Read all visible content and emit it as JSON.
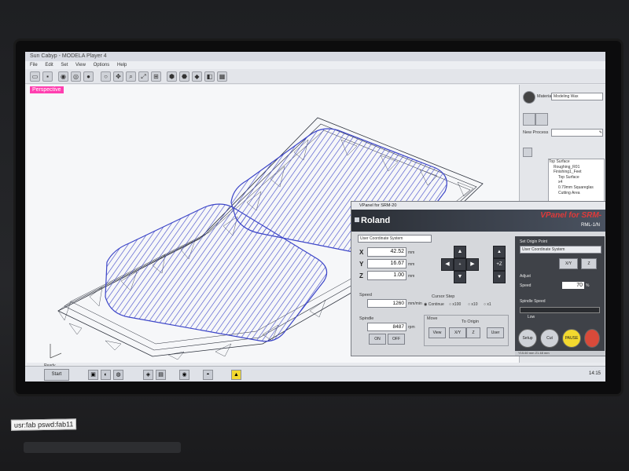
{
  "app": {
    "title": "Sun Cabyp - MODELA Player 4",
    "menu": [
      "File",
      "Edit",
      "Set",
      "View",
      "Options",
      "Help"
    ],
    "view_label": "Perspective"
  },
  "right_pane": {
    "material_label": "Material",
    "material_value": "Modeling Wax",
    "new_process_label": "New Process",
    "tree": [
      "Top Surface",
      "Roughing_R01",
      "Finishing1_Feet",
      "Top Surface",
      "x4",
      "0.79mm Squareglas",
      "Cutting Area"
    ]
  },
  "vpanel": {
    "window_title": "VPanel for SRM-20",
    "brand": "Roland",
    "product": "VPanel for SRM-",
    "model": "RML-1/N",
    "coord_system": "User Coordinate System",
    "x_value": "42.52",
    "y_value": "16.67",
    "z_value": "1.00",
    "unit": "mm",
    "speed_label": "Speed",
    "speed_value": "1260",
    "speed_unit": "mm/min",
    "spindle_label": "Spindle",
    "spindle_value": "8487",
    "spindle_unit": "rpm",
    "cursor_step_label": "Cursor Step",
    "step_options": [
      "Continue",
      "x100",
      "x10",
      "x1"
    ],
    "spindle_on": "ON",
    "spindle_off": "OFF",
    "move_label": "Move",
    "to_origin_label": "To Origin",
    "btn_view": "View",
    "btn_xy": "X/Y",
    "btn_z": "Z",
    "btn_user": "User",
    "set_origin_label": "Set Origin Point",
    "set_origin_value": "User Coordinate System",
    "btn_xyz": "X/Y",
    "btn_z2": "Z",
    "adjust_label": "Adjust",
    "adjust_speed_label": "Speed",
    "adjust_speed_value": "70",
    "adjust_unit": "%",
    "spindle_speed_label": "Spindle Speed",
    "spindle_low": "Low",
    "btn_setup": "Setup",
    "btn_cut": "Cut",
    "btn_pause": "PAUSE",
    "status_text": "Y15.60 mm Z1.48 mm"
  },
  "taskbar": {
    "ready": "Ready",
    "start": "Start",
    "clock": "14:15"
  },
  "sticker": {
    "text": "usr:fab pswd:fab11"
  },
  "colors": {
    "perspective_badge": "#ff3fb0",
    "wireframe": "#2a2f3a",
    "toolpath": "#3c45c8",
    "brand_red": "#e03a3a",
    "pause_yellow": "#f3d92f"
  }
}
